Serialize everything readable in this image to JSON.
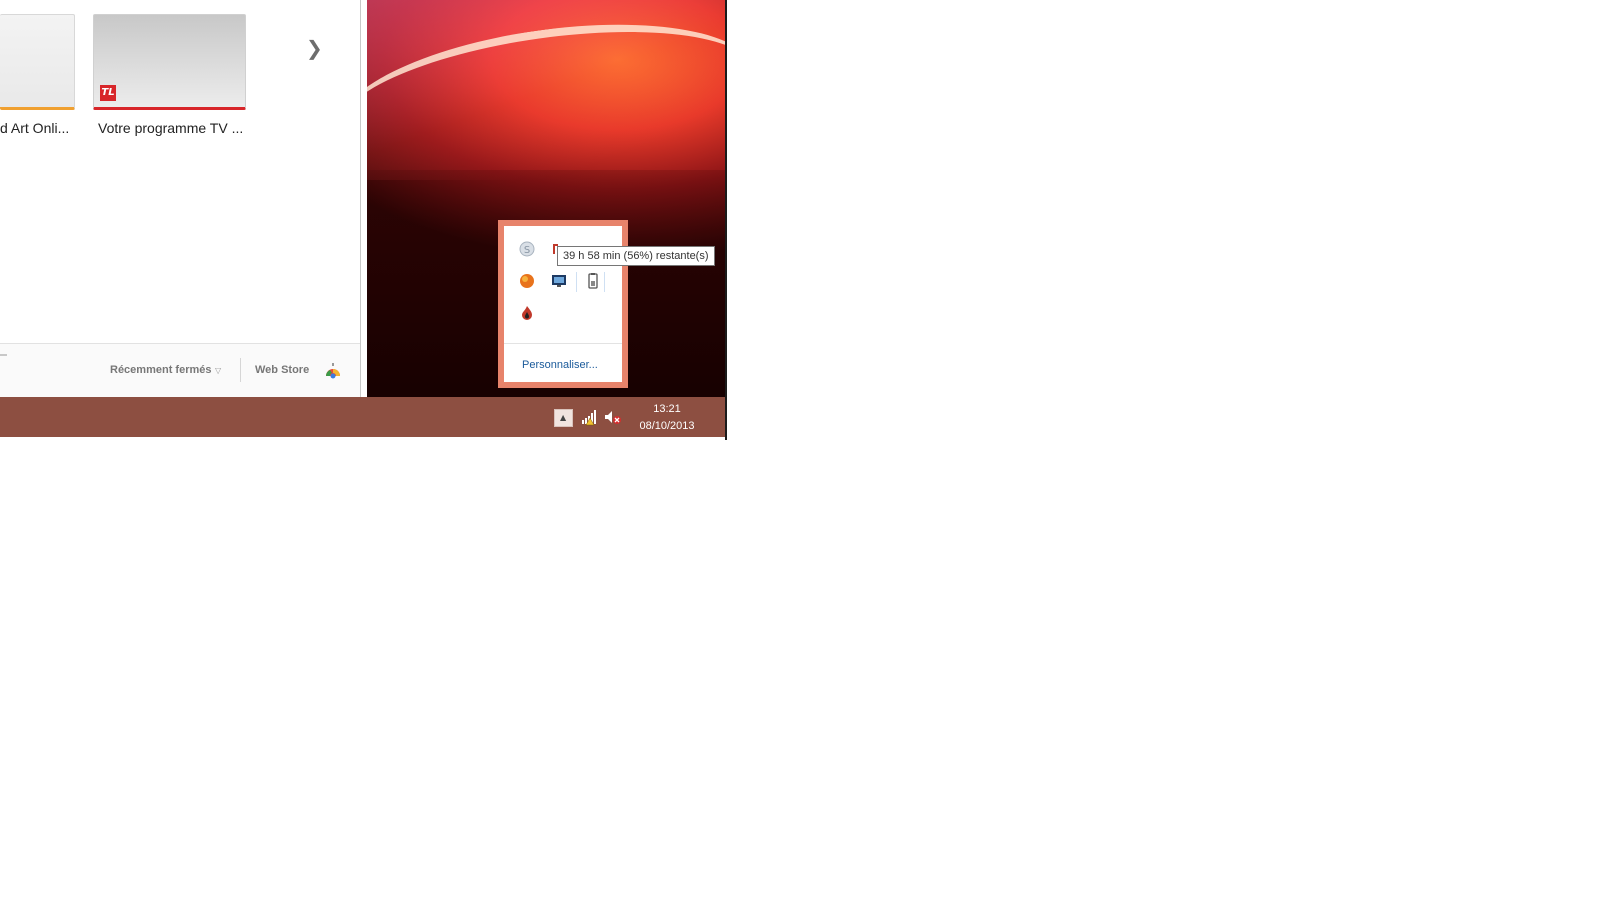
{
  "chrome": {
    "thumbnails": [
      {
        "title": "d Art Onli..."
      },
      {
        "title": "Votre programme TV ...",
        "badge": "TL"
      }
    ],
    "next_arrow": "❯",
    "footer": {
      "recently_closed": "Récemment fermés",
      "web_store": "Web Store"
    }
  },
  "tray_flyout": {
    "icons": [
      "skype-icon",
      "flash-icon",
      "ball-icon",
      "display-icon",
      "battery-icon",
      "flame-icon"
    ],
    "customize_label": "Personnaliser..."
  },
  "tooltip": {
    "text": "39 h 58 min (56%) restante(s)"
  },
  "taskbar": {
    "time": "13:21",
    "date": "08/10/2013"
  },
  "colors": {
    "taskbar": "#8d4f41",
    "flyout_border": "#e7836b",
    "link": "#1a5a9a"
  }
}
